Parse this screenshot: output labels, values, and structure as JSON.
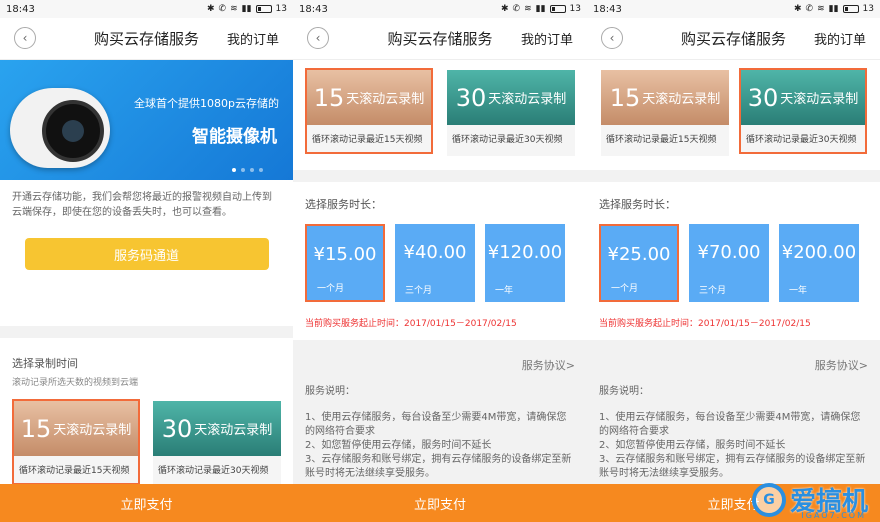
{
  "status": {
    "time": "18:43",
    "battery": "13"
  },
  "nav": {
    "back_icon": "‹",
    "title": "购买云存储服务",
    "orders": "我的订单"
  },
  "panel1": {
    "hero_sub": "全球首个提供1080p云存储的",
    "hero_main": "智能摄像机",
    "intro": "开通云存储功能，我们会帮您将最近的报警视频自动上传到云端保存，即使在您的设备丢失时，也可以查看。",
    "code_button": "服务码通道",
    "record_title": "选择录制时间",
    "record_sub": "滚动记录所选天数的视频到云端"
  },
  "plans": [
    {
      "days": "15",
      "label": "天滚动云录制",
      "desc": "循环滚动记录最近15天视频"
    },
    {
      "days": "30",
      "label": "天滚动云录制",
      "desc": "循环滚动记录最近30天视频"
    }
  ],
  "duration_title": "选择服务时长：",
  "panel2": {
    "durations": [
      {
        "price": "¥15.00",
        "term": "一个月"
      },
      {
        "price": "¥40.00",
        "term": "三个月"
      },
      {
        "price": "¥120.00",
        "term": "一年"
      }
    ]
  },
  "panel3": {
    "durations": [
      {
        "price": "¥25.00",
        "term": "一个月"
      },
      {
        "price": "¥70.00",
        "term": "三个月"
      },
      {
        "price": "¥200.00",
        "term": "一年"
      }
    ]
  },
  "valid_period": "当前购买服务起止时间：2017/01/15－2017/02/15",
  "agreement": "服务协议>",
  "notes_title": "服务说明：",
  "notes": [
    "1、使用云存储服务，每台设备至少需要4M带宽，请确保您的网络符合要求",
    "2、如您暂停使用云存储，服务时间不延长",
    "3、云存储服务和账号绑定，拥有云存储服务的设备绑定至新账号时将无法继续享受服务。"
  ],
  "pay_button": "立即支付",
  "watermark": {
    "text": "爱搞机",
    "url": "IGAO7.COM"
  },
  "colors": {
    "accent": "#f6891f",
    "blue": "#5aabf5",
    "selected_border": "#f26b3a",
    "yellow": "#f7c531"
  }
}
